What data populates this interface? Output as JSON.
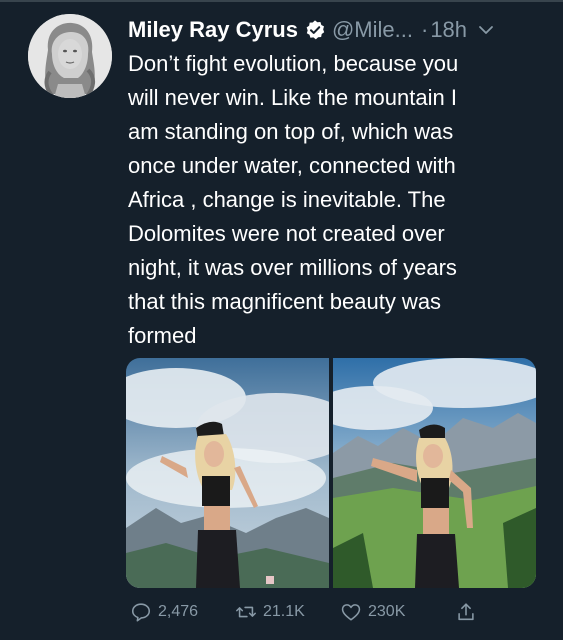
{
  "tweet": {
    "author_name": "Miley Ray Cyrus",
    "handle": "@Mile...",
    "dot": "·",
    "time": "18h",
    "text": "Don’t fight evolution, because you\nwill never win. Like the mountain I\nam standing on top of, which was\nonce under water, connected with\nAfrica , change is inevitable. The\nDolomites were not created over\nnight, it was over millions of years\nthat this magnificent beauty was\nformed",
    "verified": true
  },
  "actions": {
    "replies": "2,476",
    "retweets": "21.1K",
    "likes": "230K"
  },
  "colors": {
    "background": "#15202b",
    "text": "#ffffff",
    "muted": "#8899a6",
    "verified_badge": "#ffffff",
    "divider": "#38444d"
  },
  "icons": [
    "verified-badge-icon",
    "chevron-down-icon",
    "reply-icon",
    "retweet-icon",
    "like-icon",
    "share-icon"
  ]
}
